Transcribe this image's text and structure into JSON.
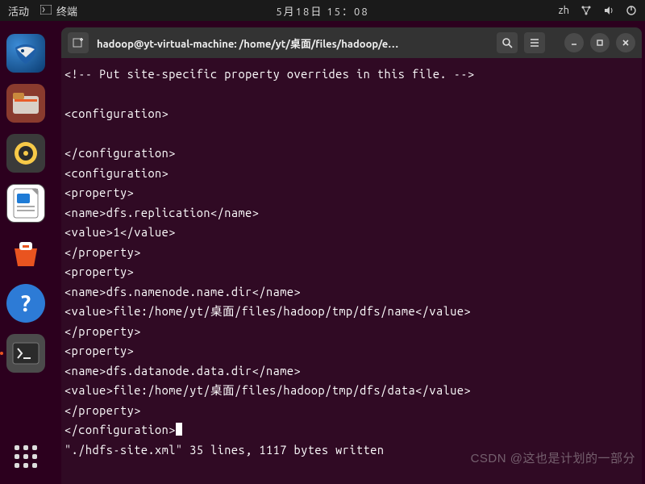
{
  "topbar": {
    "activities": "活动",
    "app_indicator": "终端",
    "datetime": "5月18日 15：08",
    "ime": "zh"
  },
  "dock": {
    "apps": [
      {
        "name": "thunderbird"
      },
      {
        "name": "files"
      },
      {
        "name": "rhythmbox"
      },
      {
        "name": "libreoffice-writer"
      },
      {
        "name": "software-store"
      },
      {
        "name": "help"
      },
      {
        "name": "terminal"
      }
    ]
  },
  "window": {
    "title": "hadoop@yt-virtual-machine: /home/yt/桌面/files/hadoop/e…"
  },
  "terminal": {
    "lines": [
      "<!-- Put site-specific property overrides in this file. -->",
      "",
      "<configuration>",
      "",
      "</configuration>",
      "<configuration>",
      "<property>",
      "<name>dfs.replication</name>",
      "<value>1</value>",
      "</property>",
      "<property>",
      "<name>dfs.namenode.name.dir</name>",
      "<value>file:/home/yt/桌面/files/hadoop/tmp/dfs/name</value>",
      "</property>",
      "<property>",
      "<name>dfs.datanode.data.dir</name>",
      "<value>file:/home/yt/桌面/files/hadoop/tmp/dfs/data</value>",
      "</property>",
      "</configuration>"
    ],
    "status": "\"./hdfs-site.xml\" 35 lines, 1117 bytes written"
  },
  "watermark": "CSDN @这也是计划的一部分"
}
